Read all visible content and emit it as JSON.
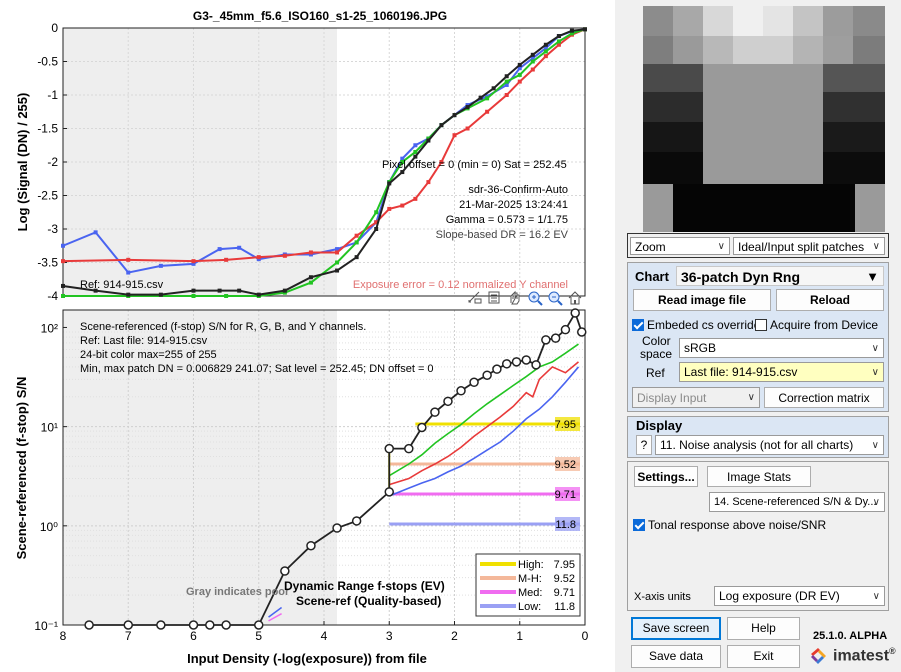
{
  "plot": {
    "title": "G3-_45mm_f5.6_ISO160_s1-25_1060196.JPG",
    "top": {
      "ylabel": "Log (Signal (DN) / 255)",
      "yticks": [
        "0",
        "-0.5",
        "-1",
        "-1.5",
        "-2",
        "-2.5",
        "-3",
        "-3.5",
        "-4"
      ],
      "pixel_offset": "Pixel offset = 0  (min = 0)  Sat = 252.45",
      "mode": "sdr-36-Confirm-Auto",
      "date": "21-Mar-2025 13:24:41",
      "gamma": "Gamma = 0.573 = 1/1.75",
      "slope_dr": "Slope-based DR = 16.2 EV",
      "ref": "Ref: 914-915.csv",
      "exposure_error": "Exposure error = 0.12 normalized Y channel"
    },
    "bottom": {
      "ylabel": "Scene-referenced (f-stop) S/N",
      "yticks": [
        "10²",
        "10¹",
        "10⁰",
        "10⁻¹"
      ],
      "xticks": [
        "8",
        "7",
        "6",
        "5",
        "4",
        "3",
        "2",
        "1",
        "0"
      ],
      "xlabel": "Input Density (-log(exposure))   from file",
      "info1": "Scene-referenced (f-stop) S/N for R, G, B, and Y channels.",
      "info2": "Ref: Last file: 914-915.csv",
      "info3": "24-bit color  max=255 of 255",
      "info4": "Min, max patch DN = 0.006829  241.07;   Sat level = 252.45;   DN offset = 0",
      "gray_note": "Gray indicates poor",
      "dr_title1": "Dynamic Range f-stops (EV)",
      "dr_title2": "Scene-ref (Quality-based)",
      "dr_labels": [
        "7.95",
        "9.52",
        "9.71",
        "11.8"
      ],
      "legend": [
        {
          "name": "High:",
          "value": "7.95"
        },
        {
          "name": "M-H:",
          "value": "9.52"
        },
        {
          "name": "Med:",
          "value": "9.71"
        },
        {
          "name": "Low:",
          "value": "11.8"
        }
      ]
    }
  },
  "colors": {
    "red": "#e83a3a",
    "green": "#22c422",
    "blue": "#4a64f0",
    "black": "#222222",
    "high": "#f0e000",
    "mh": "#f4b89a",
    "med": "#f06cf0",
    "low": "#9aa0f4",
    "panel_head": "#dbe6f4"
  },
  "chart_data": [
    {
      "type": "line",
      "title": "G3-_45mm_f5.6_ISO160_s1-25_1060196.JPG",
      "ylabel": "Log (Signal (DN) / 255)",
      "xlim": [
        8,
        0
      ],
      "ylim": [
        -4,
        0
      ],
      "series": [
        {
          "x": [
            8,
            7.5,
            7,
            6.5,
            6,
            5.6,
            5.3,
            5,
            4.6,
            4.2,
            3.8,
            3.5,
            3.2,
            3,
            2.8,
            2.6,
            2.4,
            2.2,
            2,
            1.8,
            1.5,
            1.2,
            1,
            0.8,
            0.6,
            0.4,
            0.2,
            0
          ],
          "y": [
            -3.25,
            -3.05,
            -3.65,
            -3.55,
            -3.52,
            -3.3,
            -3.28,
            -3.45,
            -3.38,
            -3.38,
            -3.3,
            -3.2,
            -2.9,
            -2.3,
            -1.95,
            -1.75,
            -1.65,
            -1.45,
            -1.3,
            -1.15,
            -1.02,
            -0.85,
            -0.6,
            -0.45,
            -0.3,
            -0.12,
            -0.05,
            -0.02
          ]
        },
        {
          "x": [
            8,
            7,
            6,
            5.5,
            5,
            4.6,
            4.2,
            3.8,
            3.5,
            3.2,
            3,
            2.8,
            2.6,
            2.4,
            2.2,
            2,
            1.8,
            1.5,
            1.2,
            1,
            0.8,
            0.6,
            0.4,
            0.2,
            0
          ],
          "y": [
            -3.48,
            -3.46,
            -3.48,
            -3.46,
            -3.42,
            -3.4,
            -3.35,
            -3.35,
            -3.1,
            -2.9,
            -2.7,
            -2.65,
            -2.55,
            -2.3,
            -2.0,
            -1.6,
            -1.5,
            -1.25,
            -1.0,
            -0.8,
            -0.62,
            -0.42,
            -0.25,
            -0.1,
            -0.02
          ]
        },
        {
          "x": [
            8,
            7,
            6,
            5.5,
            5,
            4.6,
            4.2,
            3.8,
            3.5,
            3.2,
            3,
            2.8,
            2.6,
            2.4,
            2.2,
            2,
            1.8,
            1.5,
            1.2,
            1,
            0.8,
            0.6,
            0.4,
            0.2,
            0
          ],
          "y": [
            -4,
            -4,
            -4,
            -4,
            -4,
            -3.95,
            -3.8,
            -3.5,
            -3.2,
            -2.75,
            -2.3,
            -2.0,
            -1.85,
            -1.65,
            -1.45,
            -1.3,
            -1.2,
            -1.05,
            -0.8,
            -0.7,
            -0.5,
            -0.35,
            -0.2,
            -0.08,
            -0.02
          ]
        },
        {
          "x": [
            8,
            7.5,
            7,
            6.5,
            6,
            5.6,
            5.3,
            5,
            4.6,
            4.2,
            3.8,
            3.5,
            3.2,
            3,
            2.8,
            2.6,
            2.4,
            2.2,
            2,
            1.8,
            1.6,
            1.4,
            1.2,
            1,
            0.8,
            0.6,
            0.4,
            0.2,
            0
          ],
          "y": [
            -3.85,
            -3.92,
            -3.98,
            -3.98,
            -3.92,
            -3.92,
            -3.92,
            -3.98,
            -3.92,
            -3.72,
            -3.62,
            -3.42,
            -3.0,
            -2.32,
            -2.15,
            -1.92,
            -1.68,
            -1.45,
            -1.3,
            -1.18,
            -1.04,
            -0.9,
            -0.72,
            -0.55,
            -0.4,
            -0.25,
            -0.12,
            -0.04,
            -0.02
          ]
        }
      ]
    },
    {
      "type": "line",
      "ylabel": "Scene-referenced (f-stop) S/N",
      "xlabel": "Input Density (-log(exposure))   from file",
      "xlim": [
        8,
        0
      ],
      "ylim": [
        0.1,
        150
      ],
      "yscale": "log",
      "series": [
        {
          "x": [
            7.6,
            7.0,
            6.5,
            6.0,
            5.75,
            5.5,
            5.0,
            4.6,
            4.2,
            3.8,
            3.5,
            3.0,
            3.0,
            2.7,
            2.5,
            2.3,
            2.1,
            1.9,
            1.7,
            1.5,
            1.35,
            1.2,
            1.05,
            0.9,
            0.75,
            0.6,
            0.45,
            0.3,
            0.15,
            0.05
          ],
          "y": [
            0.1,
            0.1,
            0.1,
            0.1,
            0.1,
            0.1,
            0.1,
            0.35,
            0.63,
            0.95,
            1.12,
            2.2,
            6.0,
            6.0,
            9.8,
            14,
            18,
            23,
            28,
            33,
            38,
            43,
            45,
            47,
            42,
            75,
            78,
            95,
            140,
            90
          ]
        },
        {
          "x": [
            3.0,
            2.7,
            2.5,
            2.3,
            2.1,
            1.9,
            1.7,
            1.5,
            1.3,
            1.1,
            0.9,
            0.7,
            0.5,
            0.3,
            0.1
          ],
          "y": [
            3.2,
            4.2,
            5.2,
            6.8,
            8.5,
            10.5,
            13.5,
            17,
            21,
            26,
            32,
            40,
            45,
            55,
            68
          ]
        },
        {
          "x": [
            3.0,
            2.7,
            2.5,
            2.3,
            2.1,
            1.9,
            1.7,
            1.5,
            1.3,
            1.1,
            0.9,
            0.8,
            0.7,
            0.5,
            0.3,
            0.1
          ],
          "y": [
            2.6,
            3.0,
            3.6,
            4.2,
            5.0,
            6.2,
            8.0,
            10,
            12.5,
            16,
            22,
            20,
            30,
            40,
            35,
            45
          ]
        },
        {
          "x": [
            3.0,
            2.7,
            2.5,
            2.3,
            2.1,
            1.9,
            1.7,
            1.5,
            1.3,
            1.1,
            0.9,
            0.7,
            0.5,
            0.3,
            0.1
          ],
          "y": [
            2.0,
            2.4,
            2.7,
            3.0,
            3.5,
            4.0,
            4.8,
            5.8,
            7.0,
            9.0,
            12,
            15,
            20,
            28,
            40
          ]
        }
      ]
    }
  ],
  "chart_panel": {
    "title": "Chart",
    "chart_name": "36-patch Dyn Rng",
    "read_btn": "Read image file",
    "reload_btn": "Reload",
    "embedded_cs": "Embeded cs override",
    "acquire": "Acquire from Device",
    "color_space_label1": "Color",
    "color_space_label2": "space",
    "color_space": "sRGB",
    "ref_label": "Ref",
    "ref_value": "Last file: 914-915.csv",
    "display_input": "Display Input",
    "correction": "Correction matrix"
  },
  "display_panel": {
    "title": "Display",
    "help": "?",
    "mode": "11. Noise analysis (not for all charts)"
  },
  "zoom": {
    "zoom": "Zoom",
    "ideal": "Ideal/Input split patches"
  },
  "settings_panel": {
    "settings_btn": "Settings...",
    "stats_btn": "Image Stats",
    "plot_select": "14. Scene-referenced S/N & Dy...",
    "tonal": "Tonal response above noise/SNR",
    "xaxis_label": "X-axis units",
    "xaxis_value": "Log exposure (DR EV)"
  },
  "bottom_buttons": {
    "save_screen": "Save screen",
    "help": "Help",
    "save_data": "Save data",
    "exit": "Exit",
    "version": "25.1.0. ALPHA",
    "brand": "imatest"
  }
}
